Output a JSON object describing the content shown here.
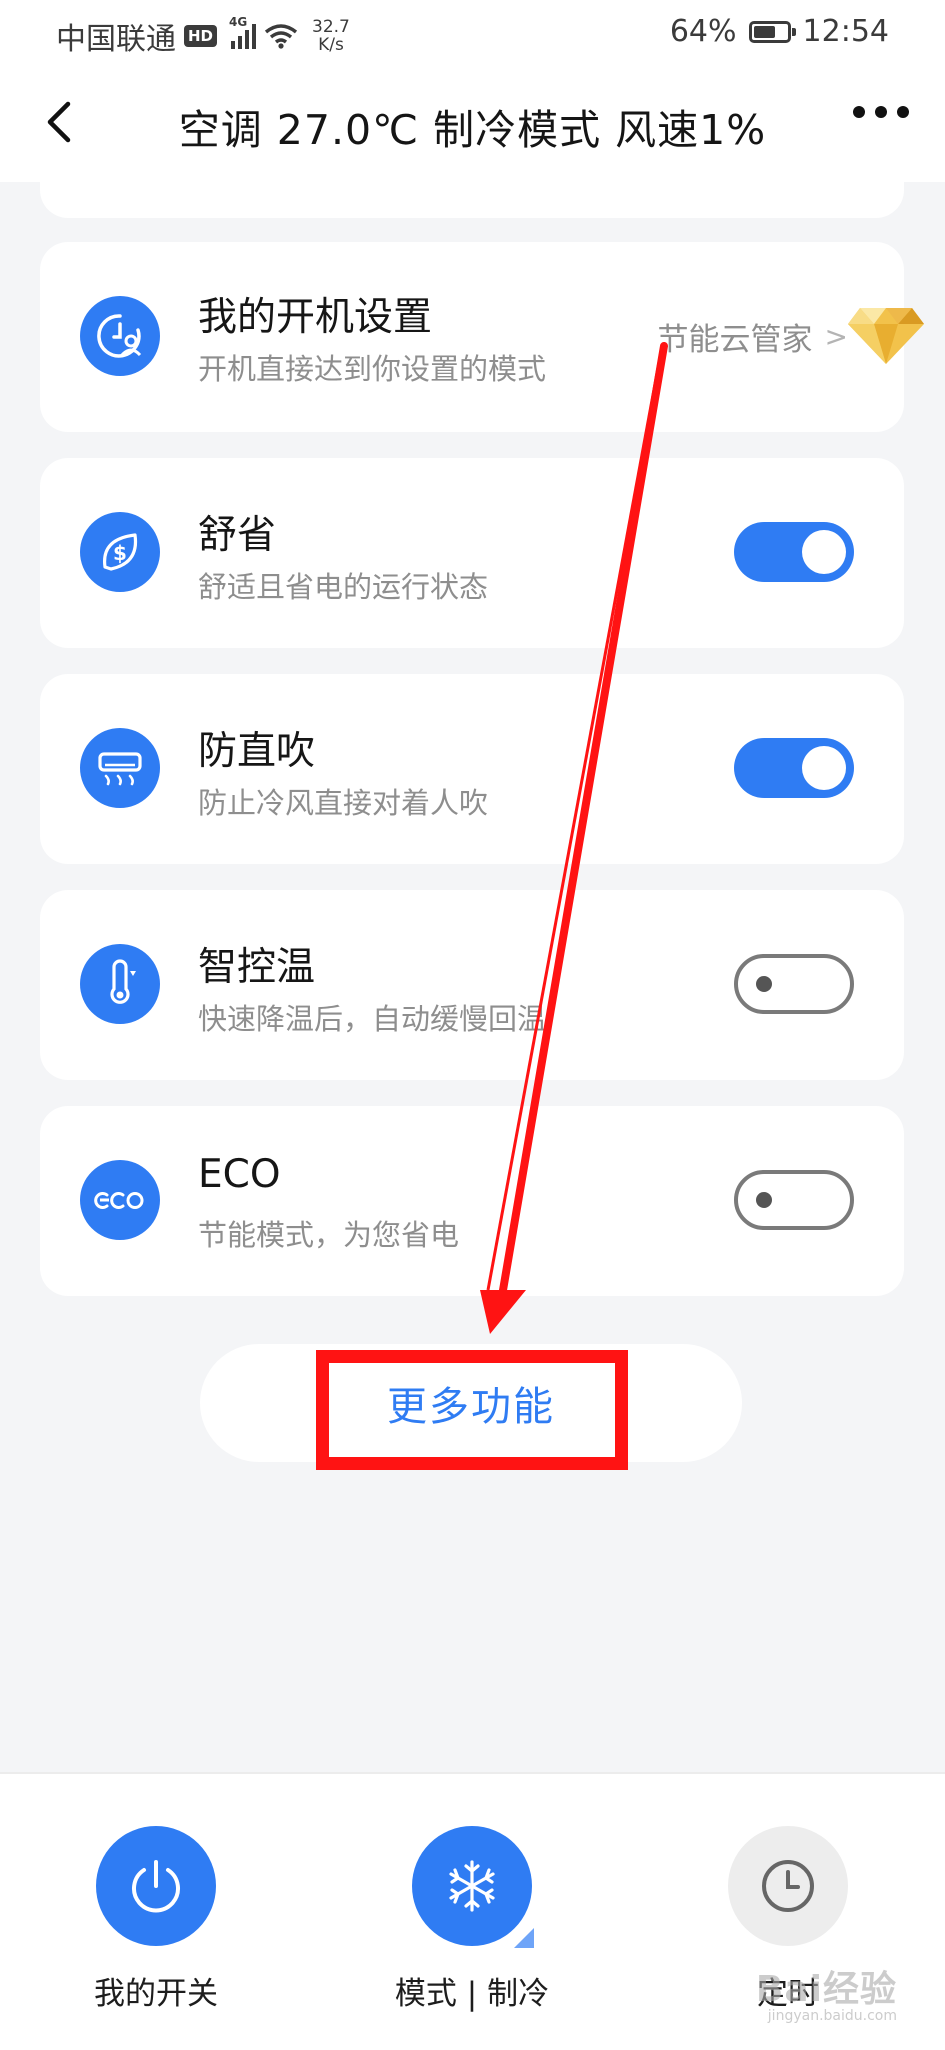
{
  "status_bar": {
    "carrier": "中国联通",
    "hd_badge": "HD",
    "network": "4G",
    "speed_value": "32.7",
    "speed_unit": "K/s",
    "battery": "64%",
    "time": "12:54"
  },
  "nav": {
    "title": "空调 27.0℃ 制冷模式 风速1%",
    "back_icon": "chevron-left-icon",
    "more_icon": "more-dots-icon"
  },
  "cards": [
    {
      "title": "我的开机设置",
      "subtitle": "开机直接达到你设置的模式",
      "icon": "clock-user-icon",
      "link": "节能云管家"
    },
    {
      "title": "舒省",
      "subtitle": "舒适且省电的运行状态",
      "icon": "leaf-dollar-icon",
      "toggle": "on"
    },
    {
      "title": "防直吹",
      "subtitle": "防止冷风直接对着人吹",
      "icon": "air-conditioner-icon",
      "toggle": "on"
    },
    {
      "title": "智控温",
      "subtitle": "快速降温后，自动缓慢回温",
      "icon": "thermometer-icon",
      "toggle": "off"
    },
    {
      "title": "ECO",
      "subtitle": "节能模式，为您省电",
      "icon": "eco-icon",
      "toggle": "off"
    }
  ],
  "more_button": "更多功能",
  "bottom_bar": [
    {
      "label": "我的开关",
      "icon": "power-icon"
    },
    {
      "label": "模式 | 制冷",
      "icon": "snowflake-icon"
    },
    {
      "label": "定时",
      "icon": "clock-icon"
    }
  ],
  "watermark": {
    "text": "Bai经验",
    "sub": "jingyan.baidu.com"
  },
  "colors": {
    "accent": "#2f7cf3",
    "annotation": "#ff1313"
  }
}
